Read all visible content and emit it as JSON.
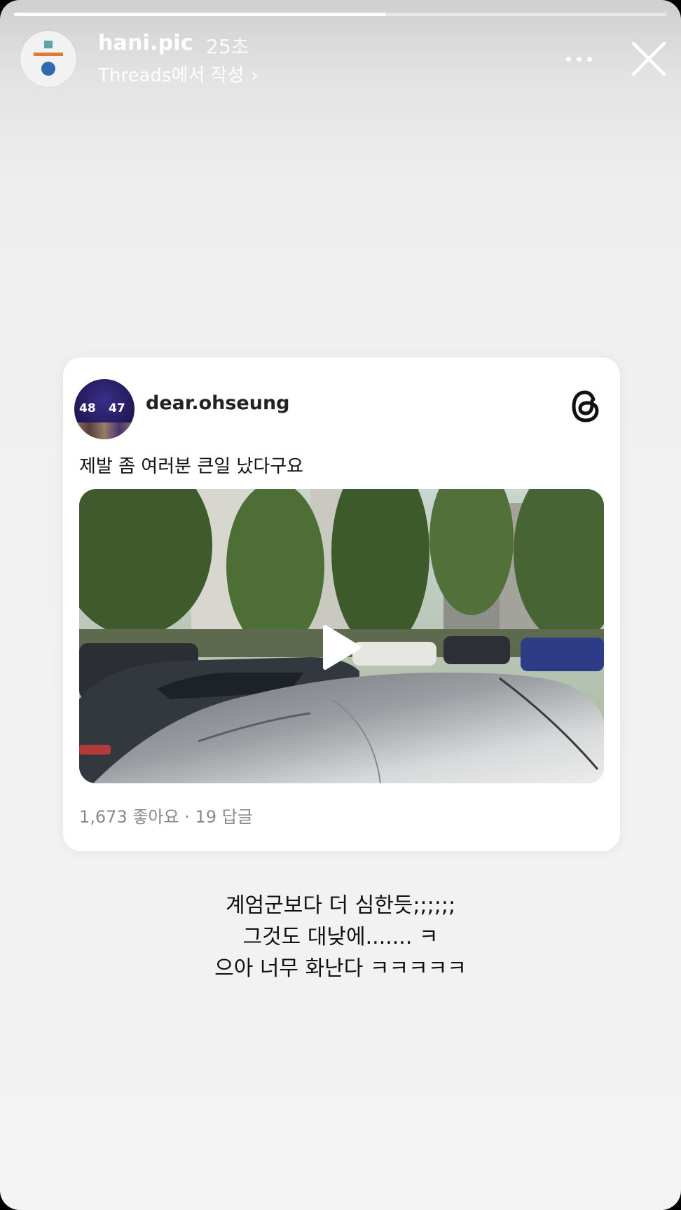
{
  "story": {
    "progress": 0.57,
    "username": "hani.pic",
    "time": "25초",
    "source": "Threads에서 작성",
    "source_chevron": "›"
  },
  "card": {
    "username": "dear.ohseung",
    "avatar_numbers": [
      "48",
      "47"
    ],
    "text": "제발 좀 여러분 큰일 났다구요",
    "stats": "1,673 좋아요 · 19 답글"
  },
  "caption": {
    "line1": "계엄군보다 더 심한듯;;;;;;",
    "line2": "그것도 대낮에....... ㅋ",
    "line3": "으아 너무 화난다 ㅋㅋㅋㅋㅋ"
  },
  "icons": [
    "more-icon",
    "close-icon",
    "threads-logo-icon",
    "play-icon",
    "chevron-right-icon"
  ]
}
